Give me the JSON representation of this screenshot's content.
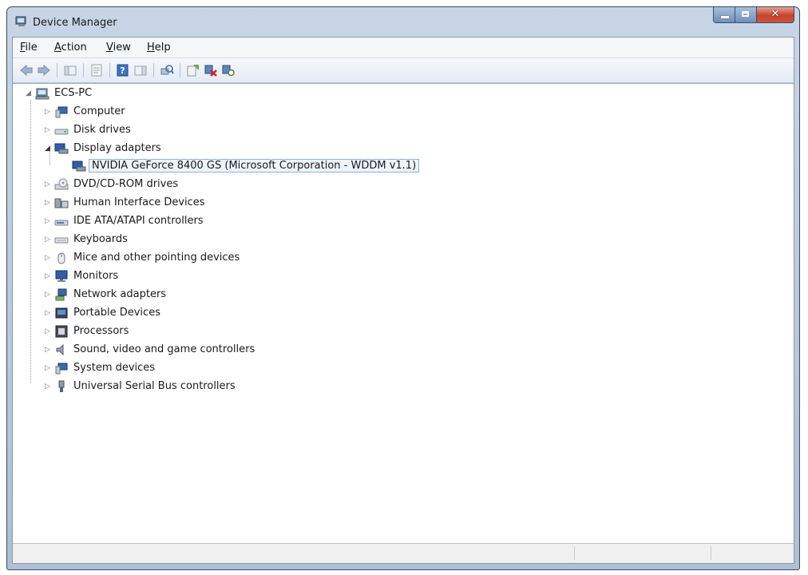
{
  "window": {
    "title": "Device Manager"
  },
  "menu": {
    "file": {
      "accel": "F",
      "rest": "ile"
    },
    "action": {
      "accel": "A",
      "rest": "ction"
    },
    "view": {
      "accel": "V",
      "rest": "iew"
    },
    "help": {
      "accel": "H",
      "rest": "elp"
    }
  },
  "toolbar": {
    "buttons": [
      "back-arrow-icon",
      "forward-arrow-icon",
      "show-hide-console-tree-icon",
      "properties-icon",
      "help-icon",
      "action-pane-icon",
      "scan-hardware-icon",
      "update-driver-icon",
      "uninstall-icon",
      "disable-device-icon"
    ]
  },
  "tree": {
    "root": "ECS-PC",
    "categories": [
      {
        "label": "Computer",
        "icon": "computer-icon"
      },
      {
        "label": "Disk drives",
        "icon": "disk-drive-icon"
      },
      {
        "label": "Display adapters",
        "icon": "display-adapter-icon",
        "expanded": true,
        "children": [
          {
            "label": "NVIDIA GeForce 8400 GS (Microsoft Corporation - WDDM v1.1)",
            "icon": "display-adapter-icon"
          }
        ]
      },
      {
        "label": "DVD/CD-ROM drives",
        "icon": "dvd-drive-icon"
      },
      {
        "label": "Human Interface Devices",
        "icon": "hid-icon"
      },
      {
        "label": "IDE ATA/ATAPI controllers",
        "icon": "ide-controller-icon"
      },
      {
        "label": "Keyboards",
        "icon": "keyboard-icon"
      },
      {
        "label": "Mice and other pointing devices",
        "icon": "mouse-icon"
      },
      {
        "label": "Monitors",
        "icon": "monitor-icon"
      },
      {
        "label": "Network adapters",
        "icon": "network-adapter-icon"
      },
      {
        "label": "Portable Devices",
        "icon": "portable-device-icon"
      },
      {
        "label": "Processors",
        "icon": "processor-icon"
      },
      {
        "label": "Sound, video and game controllers",
        "icon": "speaker-icon"
      },
      {
        "label": "System devices",
        "icon": "system-device-icon"
      },
      {
        "label": "Universal Serial Bus controllers",
        "icon": "usb-icon"
      }
    ]
  },
  "colors": {
    "title_bar": "#b9cbe2",
    "close_button": "#c7402a",
    "selection_border": "#8fb1d9"
  }
}
